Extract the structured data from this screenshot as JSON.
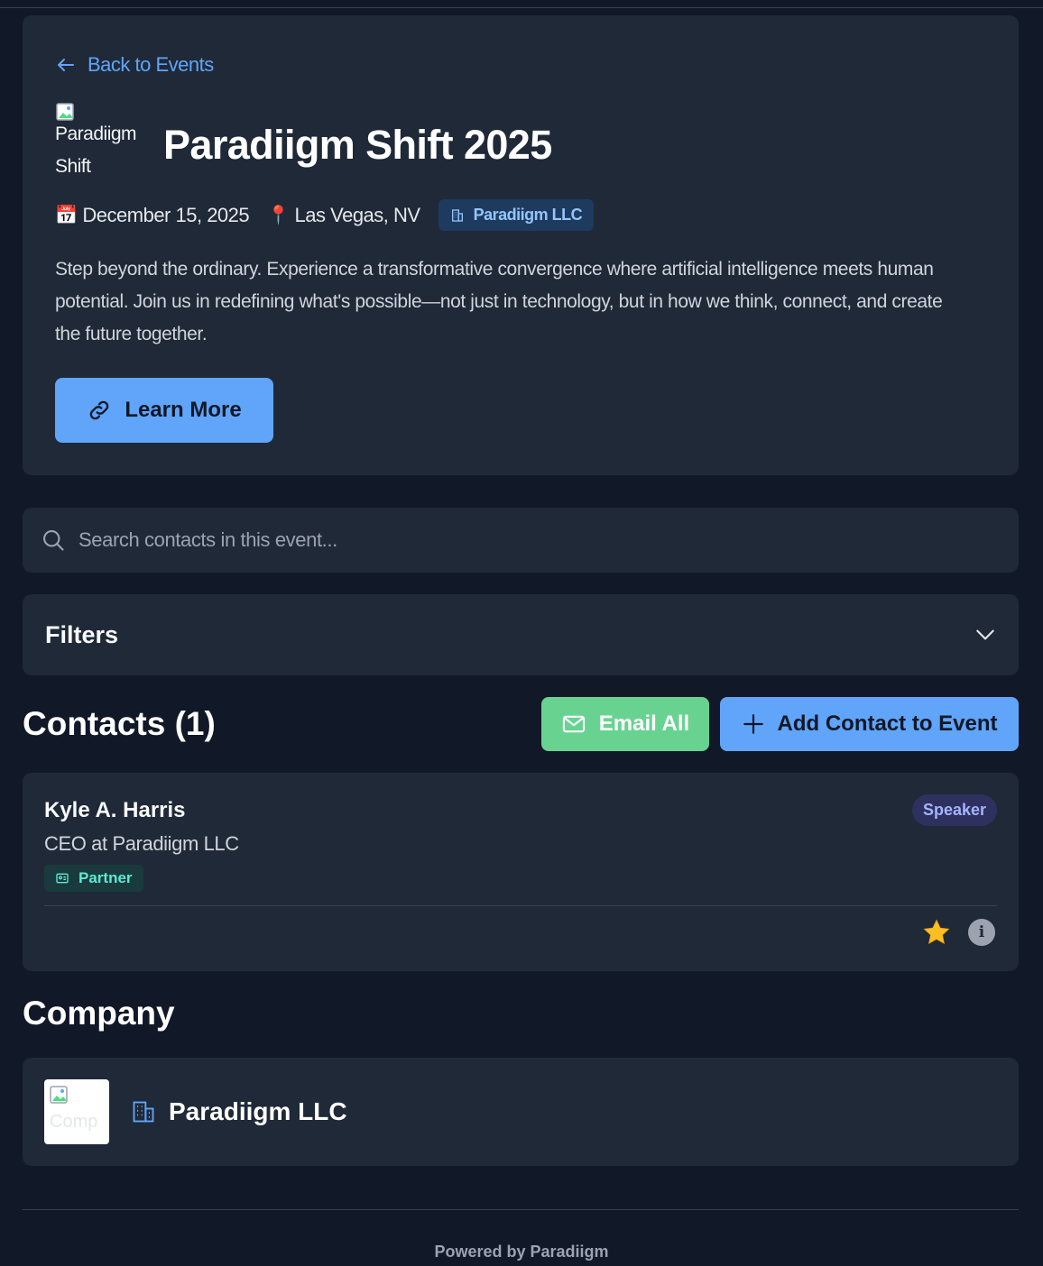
{
  "hero": {
    "back_label": "Back to Events",
    "logo_alt_line1": "Paradiigm",
    "logo_alt_line2": "Shift",
    "title": "Paradiigm Shift 2025",
    "date_emoji": "📅",
    "date": "December 15, 2025",
    "location_emoji": "📍",
    "location": "Las Vegas, NV",
    "organizer": "Paradiigm LLC",
    "description": "Step beyond the ordinary. Experience a transformative convergence where artificial intelligence meets human potential. Join us in redefining what's possible—not just in technology, but in how we think, connect, and create the future together.",
    "learn_more_label": "Learn More"
  },
  "search": {
    "placeholder": "Search contacts in this event...",
    "value": ""
  },
  "filters": {
    "label": "Filters"
  },
  "contacts": {
    "title": "Contacts (1)",
    "email_all_label": "Email All",
    "add_contact_label": "Add Contact to Event",
    "items": [
      {
        "name": "Kyle A. Harris",
        "role": "CEO at Paradiigm LLC",
        "tag": "Partner",
        "badge": "Speaker"
      }
    ]
  },
  "company": {
    "title": "Company",
    "logo_alt": "Comp",
    "name": "Paradiigm LLC"
  },
  "footer": {
    "text": "Powered by Paradiigm"
  },
  "colors": {
    "background": "#111827",
    "card": "#1f2937",
    "accent_blue": "#60a5fa",
    "accent_green": "#68d391",
    "partner_teal": "#5eead4",
    "speaker_indigo": "#a5b4fc",
    "star_yellow": "#fbbf24"
  }
}
